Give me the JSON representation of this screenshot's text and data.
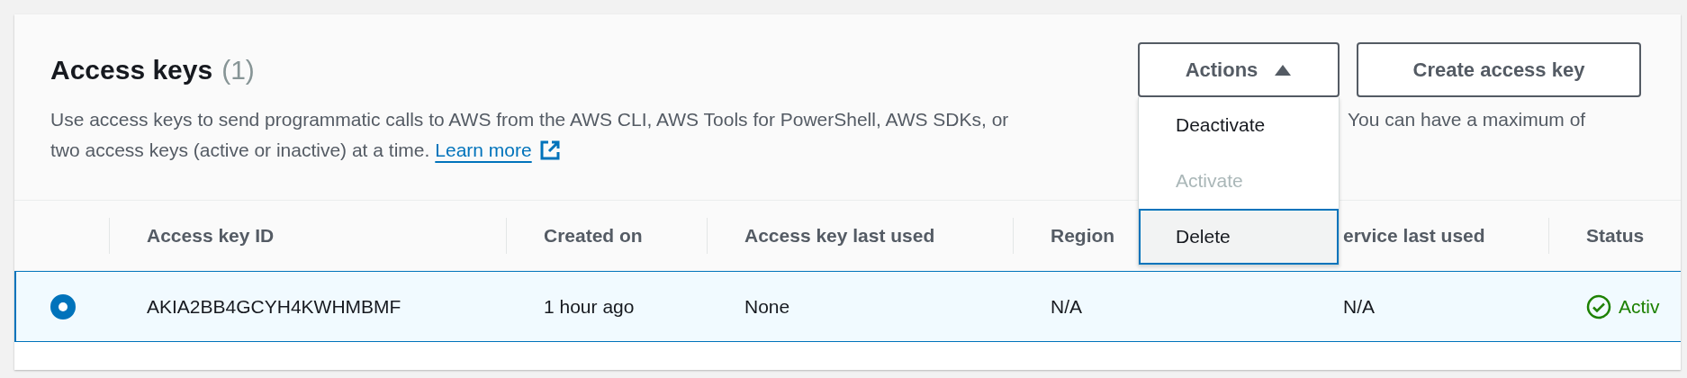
{
  "panel": {
    "title": "Access keys",
    "count": "(1)",
    "description_before": "Use access keys to send programmatic calls to AWS from the AWS CLI, AWS Tools for PowerShell, AWS SDKs, or",
    "description_after": "You can have a maximum of",
    "description_line2": "two access keys (active or inactive) at a time.",
    "link": "Learn more"
  },
  "actions": {
    "label": "Actions",
    "expanded": true,
    "menu": [
      {
        "label": "Deactivate",
        "disabled": false,
        "selected": false
      },
      {
        "label": "Activate",
        "disabled": true,
        "selected": false
      },
      {
        "label": "Delete",
        "disabled": false,
        "selected": true
      }
    ]
  },
  "create_button": "Create access key",
  "table": {
    "columns": [
      "Access key ID",
      "Created on",
      "Access key last used",
      "Region",
      "ervice last used",
      "Status"
    ],
    "rows": [
      {
        "selected": true,
        "cells": [
          "AKIA2BB4GCYH4KWHMBMF",
          "1 hour ago",
          "None",
          "N/A",
          "N/A"
        ],
        "status": {
          "text": "Activ",
          "kind": "success"
        }
      }
    ]
  }
}
